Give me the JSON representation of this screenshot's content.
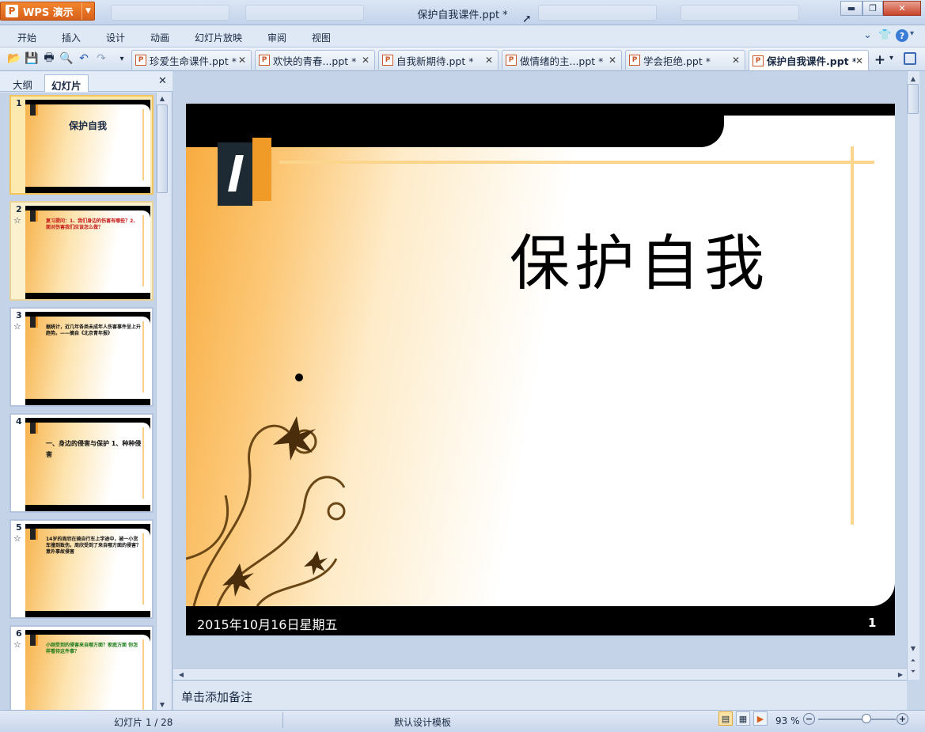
{
  "app": {
    "brand": "WPS 演示",
    "brand_icon": "P",
    "window_title": "保护自我课件.ppt *"
  },
  "menu": [
    "开始",
    "插入",
    "设计",
    "动画",
    "幻灯片放映",
    "审阅",
    "视图"
  ],
  "doc_tabs": [
    {
      "label": "珍爱生命课件.ppt *",
      "active": false
    },
    {
      "label": "欢快的青春...ppt *",
      "active": false
    },
    {
      "label": "自我新期待.ppt *",
      "active": false
    },
    {
      "label": "做情绪的主...ppt *",
      "active": false
    },
    {
      "label": "学会拒绝.ppt *",
      "active": false
    },
    {
      "label": "保护自我课件.ppt *",
      "active": true
    }
  ],
  "panel": {
    "tabs": [
      "大纲",
      "幻灯片"
    ],
    "active_tab": "幻灯片",
    "thumbnails": [
      {
        "num": "1",
        "star": false,
        "title": "保护自我",
        "text": "",
        "selected": true
      },
      {
        "num": "2",
        "star": true,
        "title": "",
        "text": "复习提问：1、我们身边的伤害有哪些？2、面对伤害我们应该怎么做？",
        "selected": false
      },
      {
        "num": "3",
        "star": true,
        "title": "",
        "text": "据统计，近几年各类未成年人伤害事件呈上升趋势。——摘自《北京青年报》",
        "selected": false
      },
      {
        "num": "4",
        "star": false,
        "title": "",
        "text": "一、身边的侵害与保护 1、种种侵害",
        "selected": false
      },
      {
        "num": "5",
        "star": true,
        "title": "",
        "text": "14岁的周欣在骑自行车上学途中，被一小货车撞到致伤。周欣受到了来自哪方面的侵害？意外事故侵害",
        "selected": false
      },
      {
        "num": "6",
        "star": true,
        "title": "",
        "text": "小刚受到的侵害来自哪方面？家庭方面 你怎样看待这件事？",
        "selected": false
      }
    ]
  },
  "slide": {
    "title": "保护自我",
    "footer_date": "2015年10月16日星期五",
    "footer_page": "1"
  },
  "notes_placeholder": "单击添加备注",
  "status": {
    "slide_counter": "幻灯片 1 / 28",
    "template": "默认设计模板",
    "zoom": "93 %",
    "zoom_fraction": 0.62
  },
  "icons": [
    "wps-logo-icon",
    "open-icon",
    "save-icon",
    "print-icon",
    "preview-icon",
    "undo-icon",
    "redo-icon",
    "new-tab-icon",
    "help-icon",
    "skin-icon"
  ],
  "colors": {
    "accent": "#f2862e",
    "slide_line": "#fcd58d",
    "selected_thumb": "#f2c45a"
  }
}
